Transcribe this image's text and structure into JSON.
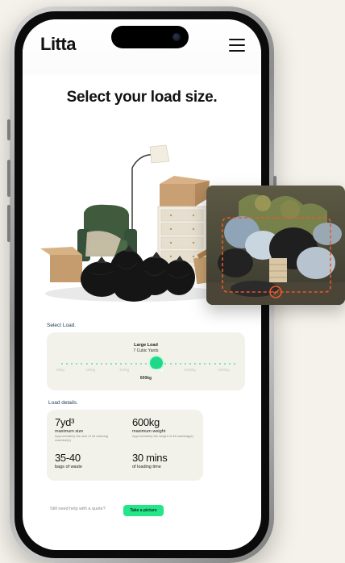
{
  "brand": {
    "logo": "Litta"
  },
  "page": {
    "title": "Select your load size."
  },
  "select_load": {
    "label": "Select Load.",
    "load_name": "Large Load",
    "load_volume": "7 Cubic Yards",
    "selected_weight": "600kg",
    "tick_labels": [
      "50kg",
      "100kg",
      "400kg",
      "600kg",
      "1000kg",
      "1500kg"
    ],
    "slider_level_fraction": 0.55
  },
  "load_details": {
    "label": "Load details.",
    "size_value": "7yd³",
    "size_label": "maximum size",
    "size_desc": "Approximately the size of 18 washing machine(s)",
    "weight_value": "600kg",
    "weight_label": "maximum weight",
    "weight_desc": "Approximately the weight of 48 sandbag(s)",
    "bags_value": "35-40",
    "bags_label": "bags of waste",
    "time_value": "30 mins",
    "time_label": "of loading time"
  },
  "footer": {
    "help_text": "Still need help with a quote?",
    "cta_label": "Take a picture"
  },
  "colors": {
    "accent": "#23e58a",
    "card_bg": "#f3f2ea",
    "page_bg": "#f4f2ea"
  }
}
